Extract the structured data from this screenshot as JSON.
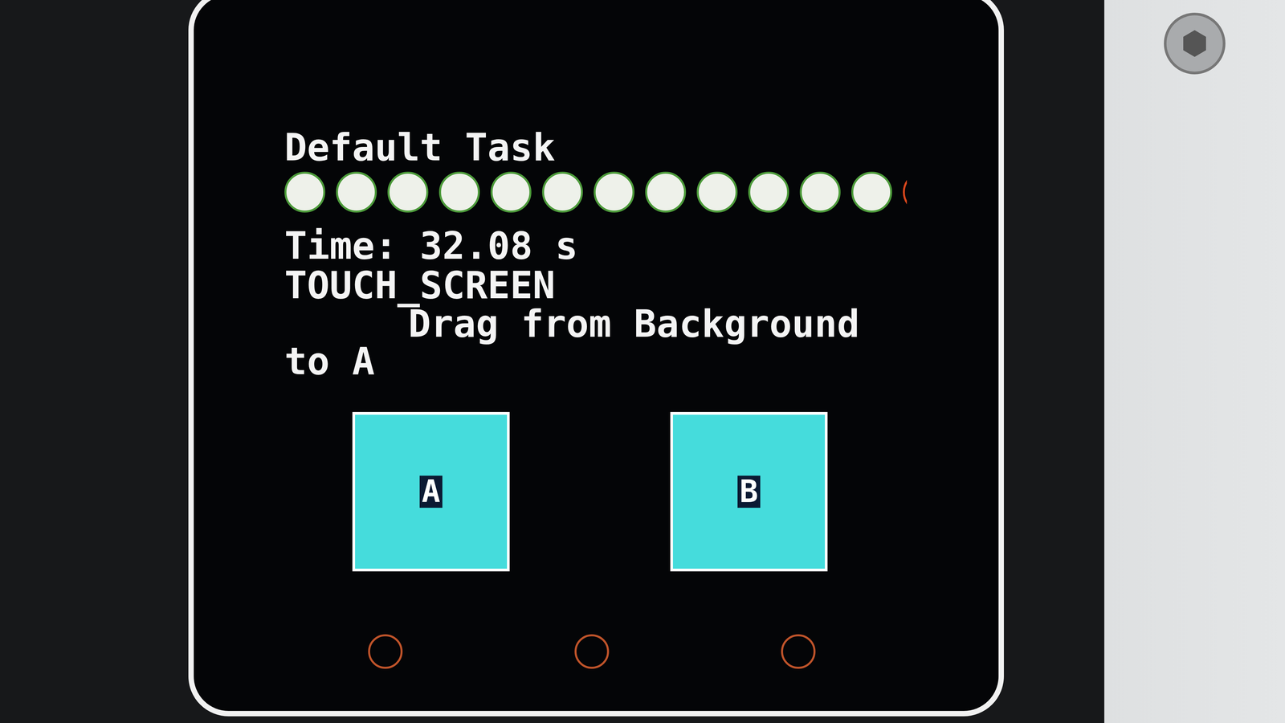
{
  "screen": {
    "title": "Default Task",
    "time": "Time: 32.08 s",
    "mode": "TOUCH_SCREEN",
    "instruction": "Drag from Background to A"
  },
  "progress": [
    {
      "done": true
    },
    {
      "done": true
    },
    {
      "done": true
    },
    {
      "done": true
    },
    {
      "done": true
    },
    {
      "done": true
    },
    {
      "done": true
    },
    {
      "done": true
    },
    {
      "done": true
    },
    {
      "done": true
    },
    {
      "done": true
    },
    {
      "done": true
    },
    {
      "done": false
    },
    {
      "done": false
    }
  ],
  "targets": [
    {
      "label": "A"
    },
    {
      "label": "B"
    }
  ],
  "hard_buttons": [
    {
      "lit": false
    },
    {
      "lit": false
    },
    {
      "lit": false
    }
  ]
}
